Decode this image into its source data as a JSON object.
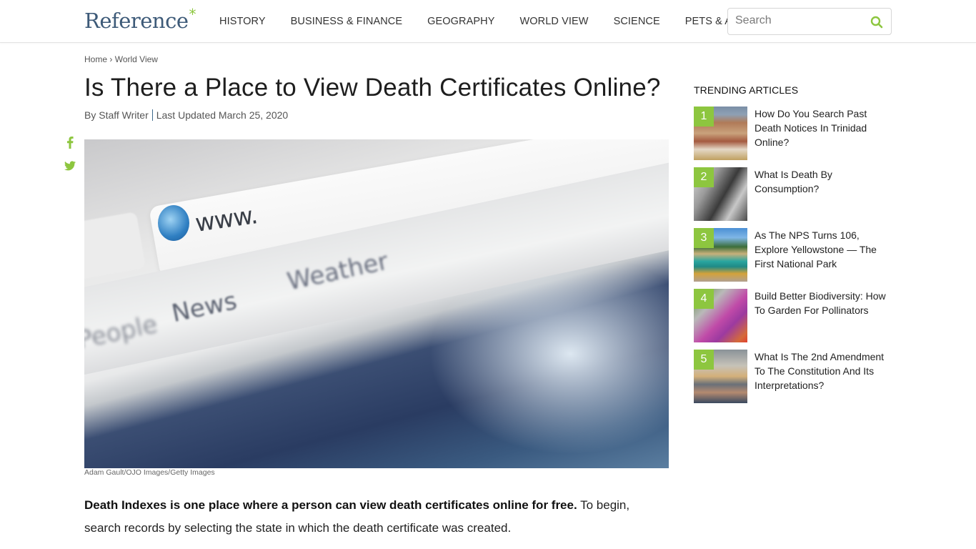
{
  "header": {
    "logo_text": "Reference",
    "logo_mark": "*",
    "nav": [
      "HISTORY",
      "BUSINESS & FINANCE",
      "GEOGRAPHY",
      "WORLD VIEW",
      "SCIENCE",
      "PETS & ANIMALS"
    ],
    "search": {
      "placeholder": "Search",
      "value": "",
      "icon": "search-icon"
    }
  },
  "breadcrumb": {
    "home": "Home",
    "separator": "›",
    "section": "World View"
  },
  "article": {
    "title": "Is There a Place to View Death Certificates Online?",
    "author": "By Staff Writer",
    "updated": "Last Updated March 25, 2020",
    "share": [
      "facebook-icon",
      "twitter-icon"
    ],
    "image_caption": "Adam Gault/OJO Images/Getty Images",
    "image_text": {
      "url": "www.",
      "tab1": "News",
      "tab2": "Weather",
      "tab0": "People"
    },
    "lead_bold": "Death Indexes is one place where a person can view death certificates online for free.",
    "lead_rest": " To begin, search records by selecting the state in which the death certificate was created."
  },
  "trending": {
    "heading": "TRENDING ARTICLES",
    "items": [
      {
        "rank": "1",
        "title": "How Do You Search Past Death Notices In Trinidad Online?"
      },
      {
        "rank": "2",
        "title": "What Is Death By Consumption?"
      },
      {
        "rank": "3",
        "title": "As The NPS Turns 106, Explore Yellowstone — The First National Park"
      },
      {
        "rank": "4",
        "title": "Build Better Biodiversity: How To Garden For Pollinators"
      },
      {
        "rank": "5",
        "title": "What Is The 2nd Amendment To The Constitution And Its Interpretations?"
      }
    ]
  },
  "colors": {
    "accent": "#8dc63f",
    "logo": "#3d5a78",
    "separator": "#3d6a8c"
  }
}
